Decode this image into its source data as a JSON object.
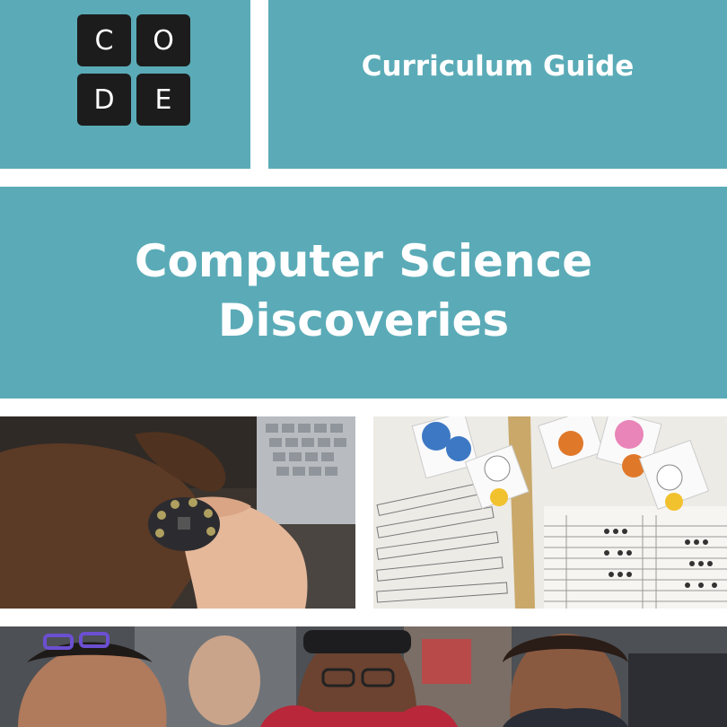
{
  "logo": {
    "letters": [
      "C",
      "O",
      "D",
      "E"
    ],
    "background": "#1c1c1c",
    "text_color": "#ffffff"
  },
  "header": {
    "subtitle": "Curriculum Guide"
  },
  "title": {
    "line1": "Computer Science",
    "line2": "Discoveries"
  },
  "colors": {
    "panel": "#5aabb7",
    "text": "#ffffff",
    "gutter": "#ffffff"
  },
  "photos": [
    {
      "name": "hands-holding-circuit-board-photo"
    },
    {
      "name": "binary-worksheet-with-emoji-cards-photo"
    },
    {
      "name": "students-in-classroom-photo"
    }
  ]
}
